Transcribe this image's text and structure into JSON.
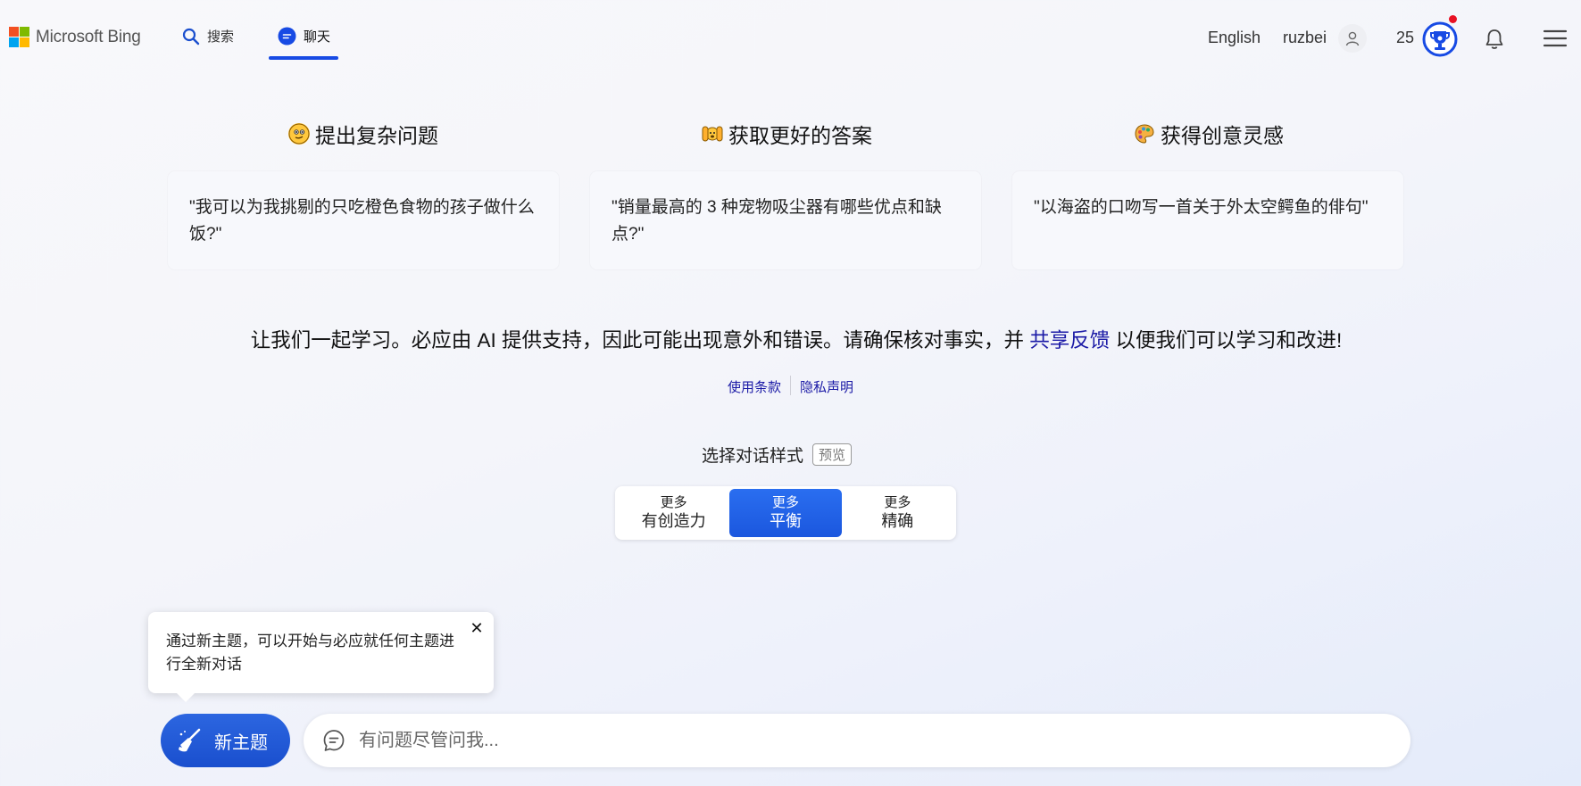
{
  "header": {
    "brand": "Microsoft Bing",
    "logo_colors": [
      "#f25022",
      "#7fba00",
      "#00a4ef",
      "#ffb900"
    ],
    "tabs": [
      {
        "label": "搜索",
        "icon": "search-icon",
        "active": false
      },
      {
        "label": "聊天",
        "icon": "chat-icon",
        "active": true
      }
    ],
    "language": "English",
    "username": "ruzbei",
    "rewards_points": "25",
    "accent_color": "#174ae4",
    "notification_dot_color": "#e81123"
  },
  "columns": [
    {
      "title": "提出复杂问题",
      "icon": "thinking-face-icon",
      "example": "\"我可以为我挑剔的只吃橙色食物的孩子做什么饭?\""
    },
    {
      "title": "获取更好的答案",
      "icon": "raised-hands-icon",
      "example": "\"销量最高的 3 种宠物吸尘器有哪些优点和缺点?\""
    },
    {
      "title": "获得创意灵感",
      "icon": "artist-palette-icon",
      "example": "\"以海盗的口吻写一首关于外太空鳄鱼的俳句\""
    }
  ],
  "disclaimer": {
    "text_before": "让我们一起学习。必应由 AI 提供支持，因此可能出现意外和错误。请确保核对事实，并 ",
    "link": "共享反馈",
    "text_after": " 以便我们可以学习和改进!"
  },
  "legal_links": {
    "terms": "使用条款",
    "privacy": "隐私声明"
  },
  "conversation_style": {
    "label": "选择对话样式",
    "badge": "预览",
    "options": [
      {
        "top": "更多",
        "bottom": "有创造力",
        "active": false
      },
      {
        "top": "更多",
        "bottom": "平衡",
        "active": true
      },
      {
        "top": "更多",
        "bottom": "精确",
        "active": false
      }
    ]
  },
  "tooltip": {
    "text": "通过新主题，可以开始与必应就任何主题进行全新对话",
    "close": "✕"
  },
  "composer": {
    "new_topic_label": "新主题",
    "placeholder": "有问题尽管问我..."
  }
}
